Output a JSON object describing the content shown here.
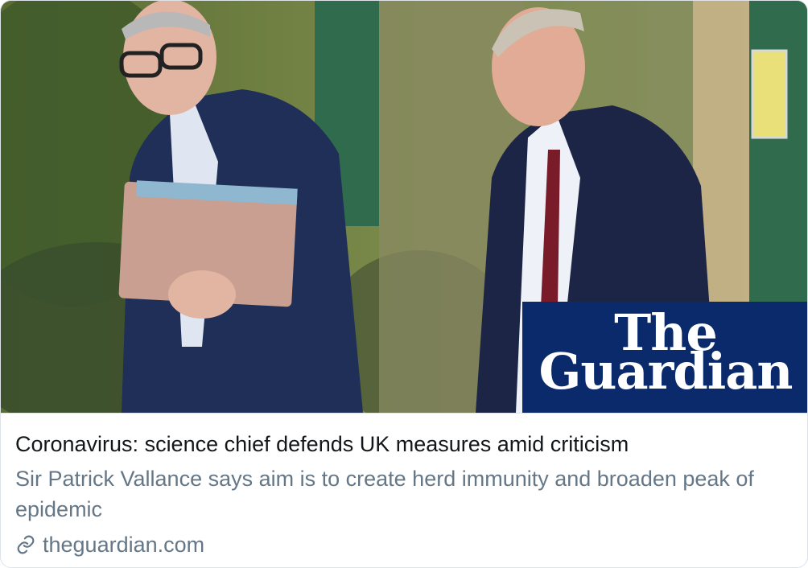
{
  "card": {
    "image_alt": "Two men in suits walking outdoors",
    "logo": {
      "line1": "The",
      "line2": "Guardian"
    },
    "headline": "Coronavirus: science chief defends UK measures amid criticism",
    "description": "Sir Patrick Vallance says aim is to create herd immunity and broaden peak of epidemic",
    "domain": "theguardian.com",
    "icons": {
      "link": "link-icon"
    },
    "colors": {
      "logo_bg": "#0b2a6b",
      "headline": "#14171a",
      "secondary": "#657786"
    }
  }
}
